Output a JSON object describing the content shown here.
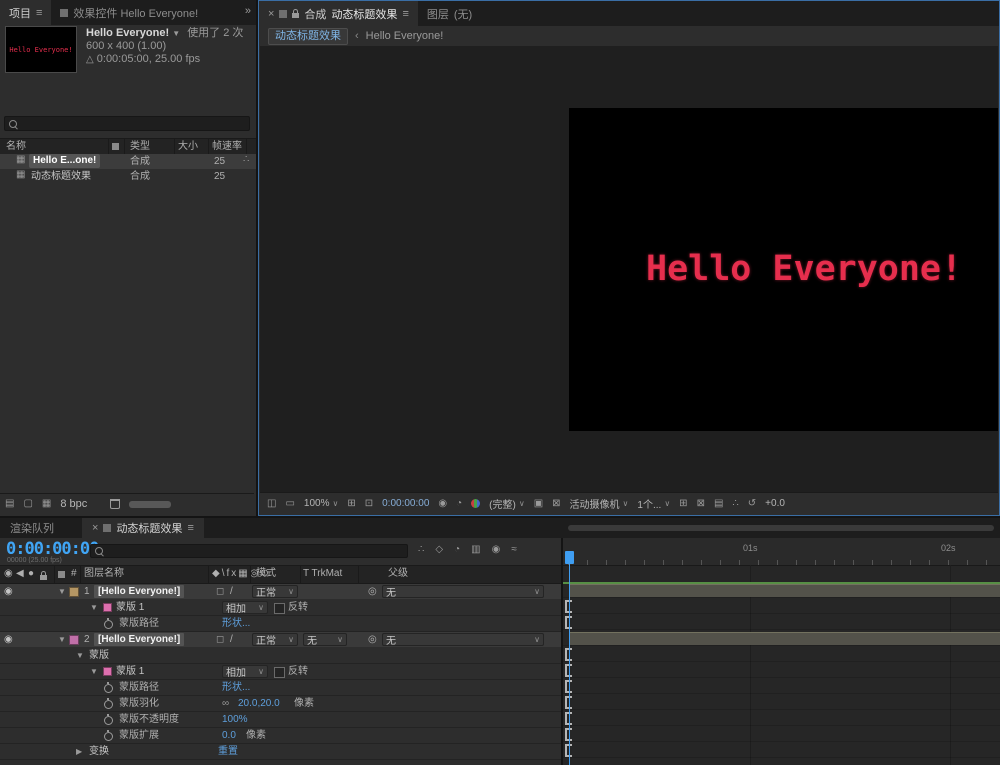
{
  "colors": {
    "accent_blue": "#3f9bfa",
    "focus_border": "#3a6ea5",
    "value_blue": "#5e9fdc",
    "title_red": "#e62e4d",
    "timecode_blue": "#40a5f5",
    "layer1_label": "#b49664",
    "layer2_label": "#c06fa8",
    "mask_swatch": "#dd6fae",
    "workarea_green": "#578f45"
  },
  "project": {
    "tab_project": "项目",
    "tab_effects": "效果控件 Hello Everyone!",
    "info": {
      "name": "Hello Everyone!",
      "thumb_text": "Hello Everyone!",
      "usage": "使用了 2 次",
      "dimensions": "600 x 400 (1.00)",
      "duration": "0:00:05:00, 25.00 fps"
    },
    "columns": {
      "name": "名称",
      "type": "类型",
      "size": "大小",
      "fps": "帧速率"
    },
    "rows": [
      {
        "name": "Hello E...one!",
        "type": "合成",
        "fps": "25"
      },
      {
        "name": "动态标题效果",
        "type": "合成",
        "fps": "25"
      }
    ],
    "footer": {
      "bpc": "8 bpc"
    }
  },
  "comp": {
    "panel_label": "合成",
    "comp_name": "动态标题效果",
    "layer_tab": "图层",
    "layer_tab_value": "(无)",
    "breadcrumb_current": "动态标题效果",
    "breadcrumb_parent": "Hello Everyone!",
    "canvas_text": "Hello Everyone!",
    "toolbar": {
      "zoom": "100%",
      "timecode": "0:00:00:00",
      "resolution": "(完整)",
      "camera": "活动摄像机",
      "views": "1个...",
      "exposure": "+0.0"
    }
  },
  "timeline": {
    "tab_render_queue": "渲染队列",
    "tab_name": "动态标题效果",
    "timecode": "0:00:00:00",
    "timecode_sub": "00000 (25.00 fps)",
    "columns": {
      "layer_name": "图层名称",
      "mode": "模式",
      "trkmat": "T TrkMat",
      "parent": "父级"
    },
    "ruler_labels": [
      "01s",
      "02s"
    ],
    "rows": [
      {
        "kind": "layer",
        "num": "1",
        "label": "[Hello Everyone!]",
        "mode": "正常",
        "parent": "无"
      },
      {
        "kind": "mask",
        "label": "蒙版 1",
        "mode": "相加",
        "invert": "反转"
      },
      {
        "kind": "prop",
        "label": "蒙版路径",
        "value": "形状..."
      },
      {
        "kind": "layer",
        "num": "2",
        "label": "[Hello Everyone!]",
        "mode": "正常",
        "trkmat": "无",
        "parent": "无"
      },
      {
        "kind": "group",
        "label": "蒙版"
      },
      {
        "kind": "mask",
        "label": "蒙版 1",
        "mode": "相加",
        "invert": "反转"
      },
      {
        "kind": "prop",
        "label": "蒙版路径",
        "value": "形状..."
      },
      {
        "kind": "prop",
        "label": "蒙版羽化",
        "value": "20.0,20.0",
        "suffix": "像素"
      },
      {
        "kind": "prop",
        "label": "蒙版不透明度",
        "value": "100%"
      },
      {
        "kind": "prop",
        "label": "蒙版扩展",
        "value": "0.0",
        "suffix": "像素"
      },
      {
        "kind": "group",
        "label": "变换",
        "value": "重置"
      }
    ]
  }
}
